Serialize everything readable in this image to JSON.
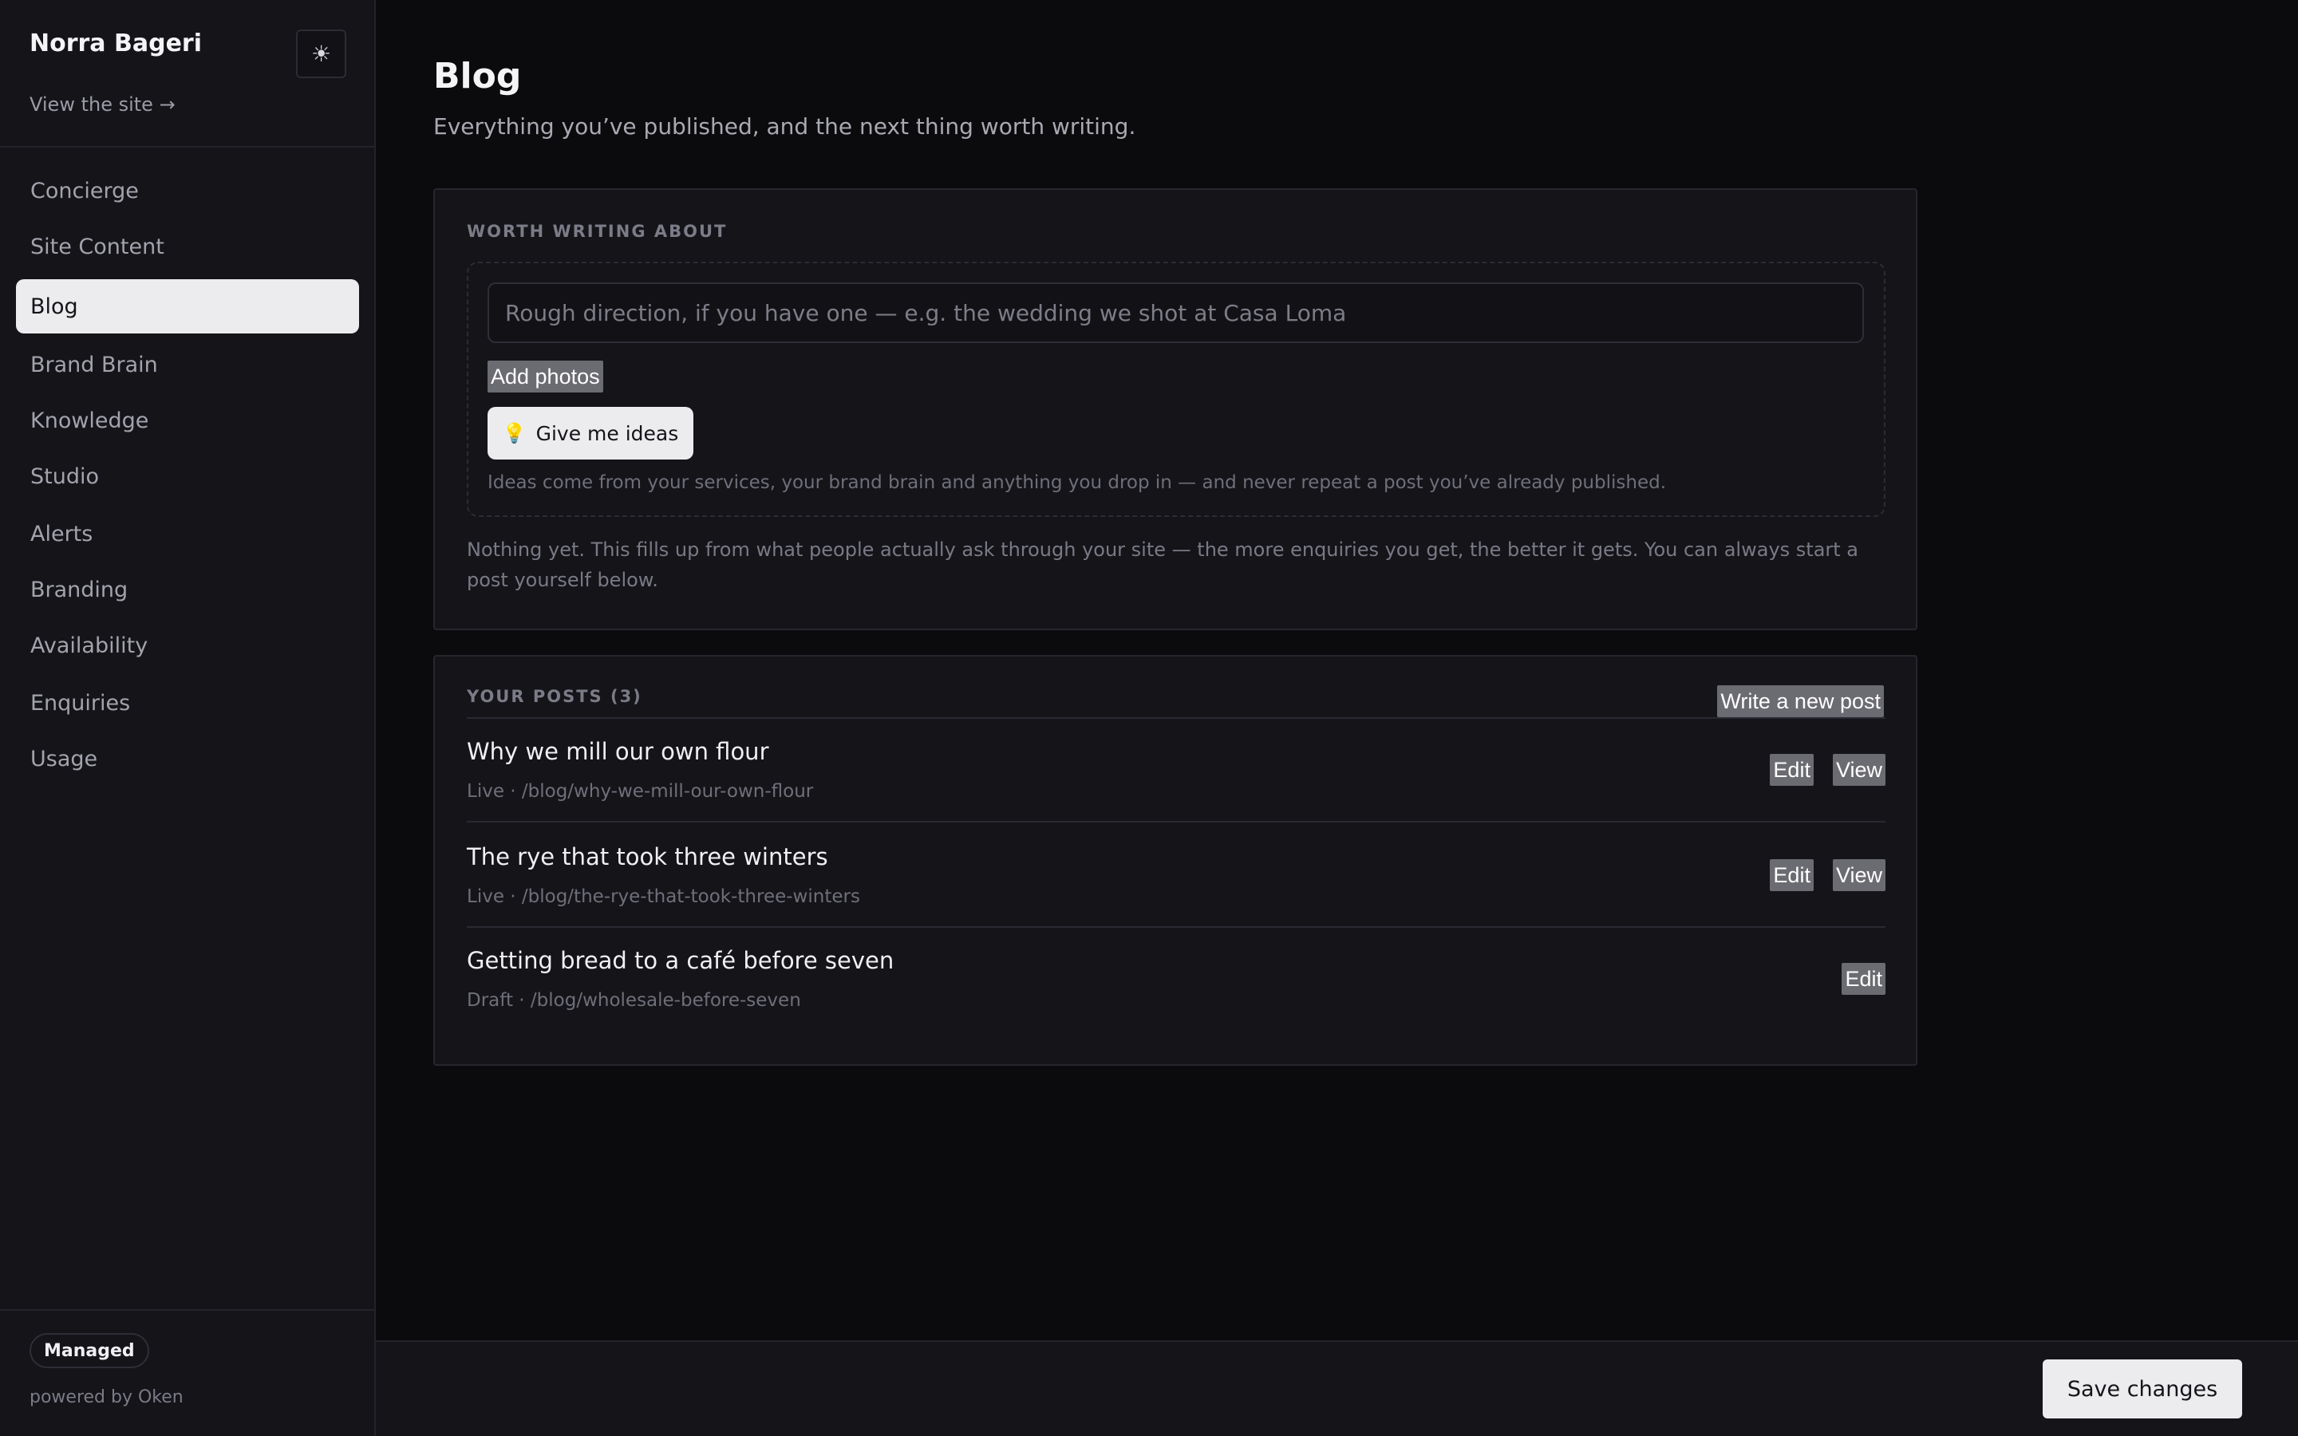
{
  "sidebar": {
    "brand_name": "Norra Bageri",
    "theme_icon": "sun-icon",
    "view_site": "View the site →",
    "items": [
      {
        "label": "Concierge"
      },
      {
        "label": "Site Content"
      },
      {
        "label": "Blog",
        "active": true
      },
      {
        "label": "Brand Brain"
      },
      {
        "label": "Knowledge"
      },
      {
        "label": "Studio"
      },
      {
        "label": "Alerts"
      },
      {
        "label": "Branding"
      },
      {
        "label": "Availability"
      },
      {
        "label": "Enquiries"
      },
      {
        "label": "Usage"
      }
    ],
    "badge": "Managed",
    "powered_by": "powered by Oken"
  },
  "main": {
    "title": "Blog",
    "subtitle": "Everything you’ve published, and the next thing worth writing."
  },
  "ideas": {
    "section_label": "WORTH WRITING ABOUT",
    "input_placeholder": "Rough direction, if you have one — e.g. the wedding we shot at Casa Loma",
    "input_value": "",
    "add_photos": "Add photos",
    "button_icon": "lightbulb-icon",
    "button_label": "Give me ideas",
    "note": "Ideas come from your services, your brand brain and anything you drop in — and never repeat a post you’ve already published.",
    "empty_note": "Nothing yet. This fills up from what people actually ask through your site — the more enquiries you get, the better it gets. You can always start a post yourself below."
  },
  "posts": {
    "section_label": "YOUR POSTS (3)",
    "new_post": "Write a new post",
    "edit_label": "Edit",
    "view_label": "View",
    "items": [
      {
        "title": "Why we mill our own flour",
        "meta": "Live · /blog/why-we-mill-our-own-flour",
        "status": "Live"
      },
      {
        "title": "The rye that took three winters",
        "meta": "Live · /blog/the-rye-that-took-three-winters",
        "status": "Live"
      },
      {
        "title": "Getting bread to a café before seven",
        "meta": "Draft · /blog/wholesale-before-seven",
        "status": "Draft"
      }
    ]
  },
  "footer": {
    "save": "Save changes"
  },
  "colors": {
    "background": "#0b0b0e",
    "surface": "#141419",
    "active_item": "#ececee",
    "muted_button": "#6b6b72",
    "lightbulb": "#e8b72e"
  }
}
